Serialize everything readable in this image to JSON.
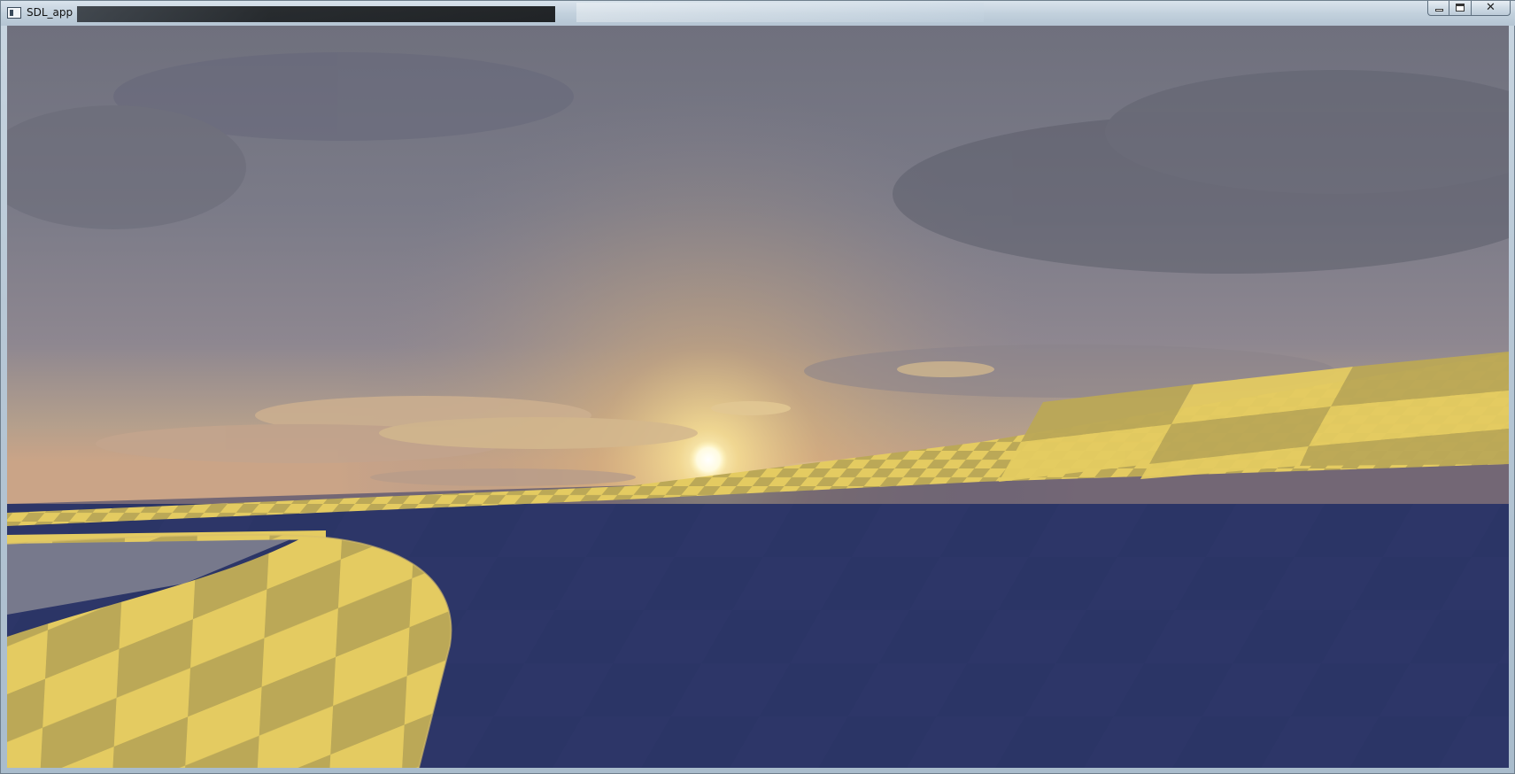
{
  "window": {
    "title": "SDL_app",
    "close_glyph": "✕"
  },
  "scene": {
    "description_icons": [
      "sun",
      "sky",
      "checkered-track",
      "blue-ground"
    ],
    "colors": {
      "sky_top": "#6d6e7c",
      "sky_horizon": "#d9b98a",
      "sun": "#fffbe0",
      "ground": "#2c3566",
      "track_light": "#e4cb61",
      "track_dark": "#bba857"
    }
  }
}
